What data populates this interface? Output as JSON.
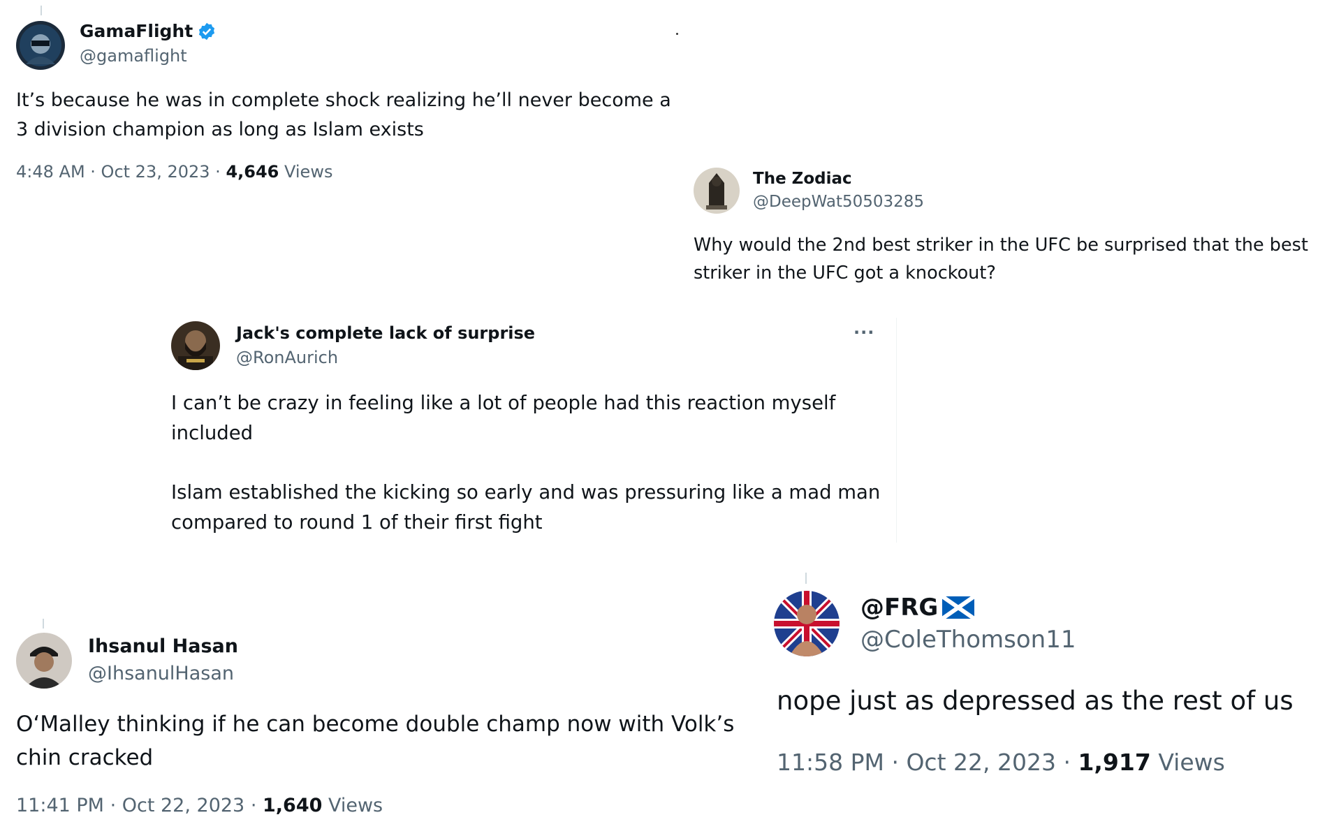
{
  "tweets": [
    {
      "display_name": "GamaFlight",
      "handle": "@gamaflight",
      "verified": true,
      "text_lines": [
        "It’s because he was in complete shock realizing he’ll never become a 3 division champion as long as Islam exists"
      ],
      "time": "4:48 AM",
      "date": "Oct 23, 2023",
      "views_count": "4,646",
      "views_label": "Views",
      "avatar_icon": "masked-figure-avatar"
    },
    {
      "display_name": "The Zodiac",
      "handle": "@DeepWat50503285",
      "text_lines": [
        "Why would the 2nd best striker in the UFC be surprised that the best striker in the UFC got a knockout?"
      ],
      "avatar_icon": "hooded-figure-avatar"
    },
    {
      "display_name": "Jack's complete lack of surprise",
      "handle": "@RonAurich",
      "more_label": "···",
      "text_paragraph_1": "I can’t be crazy in feeling like a lot of people had this reaction myself included",
      "text_paragraph_2": "Islam established the kicking so early and was pressuring like a mad man compared to round 1 of their first fight",
      "avatar_icon": "bearded-man-avatar"
    },
    {
      "display_name": "Ihsanul Hasan",
      "handle": "@IhsanulHasan",
      "text_lines": [
        "O‘Malley thinking if he can become double champ now with Volk’s chin cracked"
      ],
      "time": "11:41 PM",
      "date": "Oct 22, 2023",
      "views_count": "1,640",
      "views_label": "Views",
      "avatar_icon": "man-in-cap-avatar"
    },
    {
      "display_name": "@FRG",
      "flag_icon": "scotland-flag-icon",
      "handle": "@ColeThomson11",
      "text_lines": [
        "nope just as depressed as the rest of us"
      ],
      "time": "11:58 PM",
      "date": "Oct 22, 2023",
      "views_count": "1,917",
      "views_label": "Views",
      "avatar_icon": "fighter-australia-flag-avatar"
    }
  ],
  "separator": " · ",
  "colors": {
    "text": "#0f1419",
    "muted": "#536471",
    "verified": "#1d9bf0",
    "scotland_blue": "#005eb8"
  }
}
